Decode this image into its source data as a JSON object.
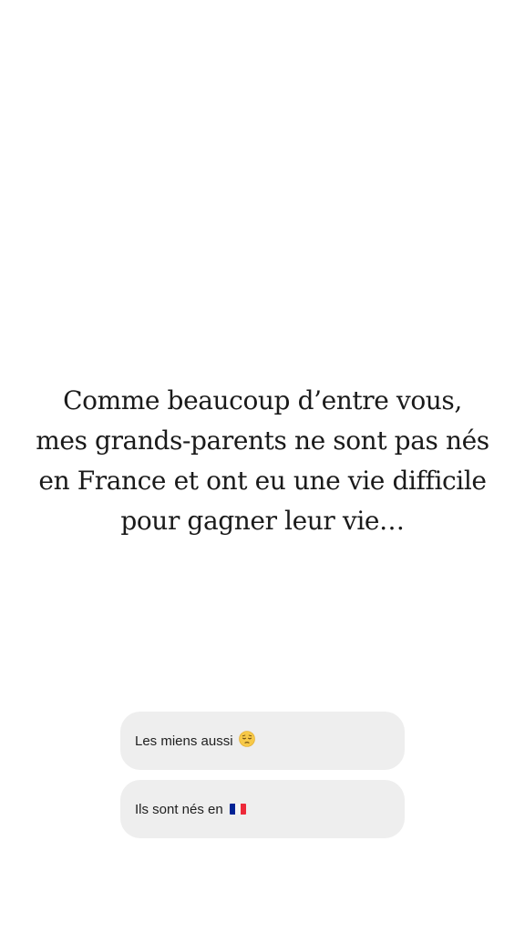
{
  "story": {
    "lines": [
      "Comme beaucoup d’entre vous,",
      "mes grands-parents ne sont pas nés",
      "en France et ont eu une vie difficile",
      "pour gagner leur vie…"
    ]
  },
  "replies": {
    "option1": {
      "label": "Les miens aussi",
      "icon": "pensive-face-emoji-icon"
    },
    "option2": {
      "label": "Ils sont nés en",
      "icon": "france-flag-icon"
    }
  },
  "colors": {
    "background": "#ffffff",
    "text": "#1a1a1a",
    "reply_background": "#eeeeee",
    "emoji_yellow": "#f7c948",
    "flag_blue": "#002395",
    "flag_white": "#ffffff",
    "flag_red": "#ed2939"
  }
}
